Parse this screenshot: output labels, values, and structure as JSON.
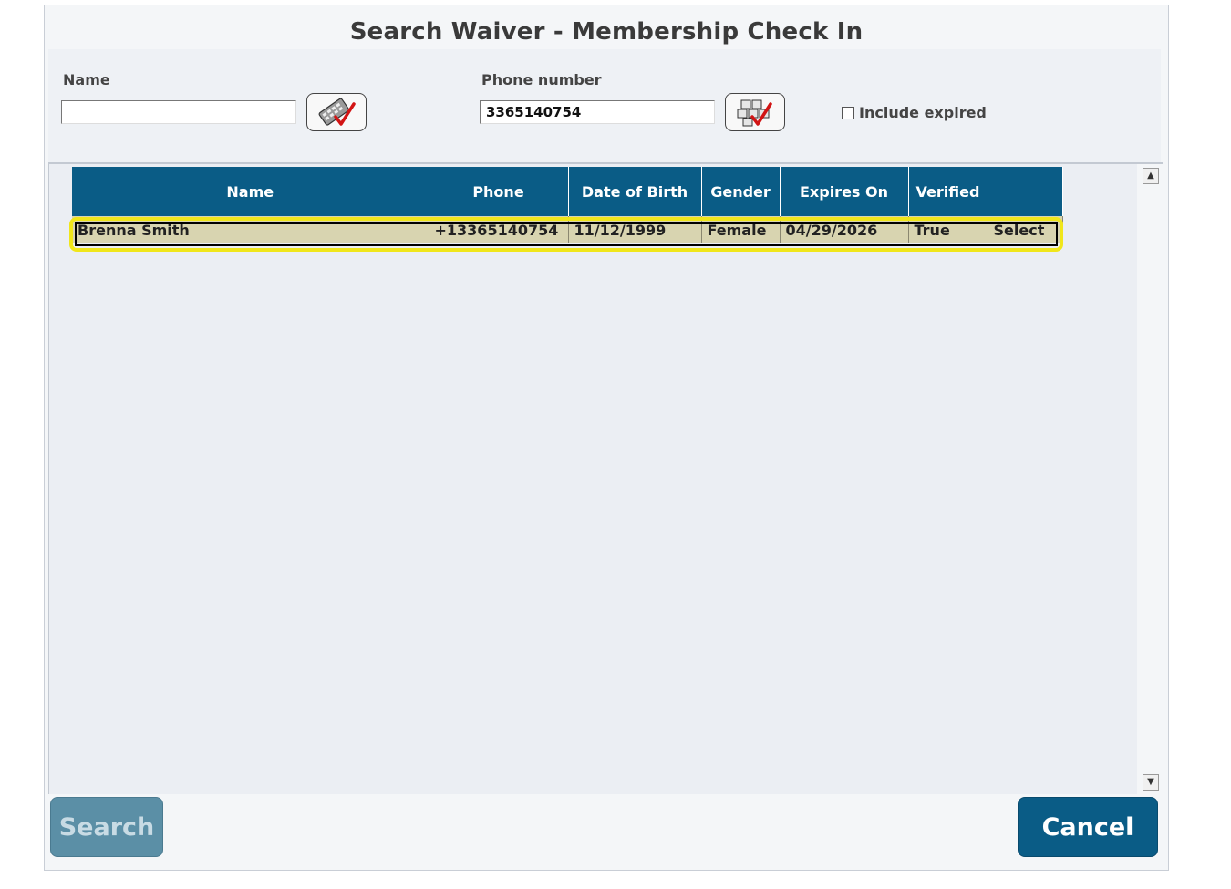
{
  "dialog": {
    "title": "Search Waiver - Membership Check In"
  },
  "form": {
    "name_label": "Name",
    "name_value": "",
    "phone_label": "Phone number",
    "phone_value": "3365140754",
    "include_expired_label": "Include expired",
    "include_expired_checked": false
  },
  "table": {
    "headers": [
      "Name",
      "Phone",
      "Date of Birth",
      "Gender",
      "Expires On",
      "Verified",
      ""
    ],
    "rows": [
      {
        "name": "Brenna Smith",
        "phone": "+13365140754",
        "dob": "11/12/1999",
        "gender": "Female",
        "expires_on": "04/29/2026",
        "verified": "True",
        "action": "Select"
      }
    ]
  },
  "buttons": {
    "search": "Search",
    "cancel": "Cancel"
  },
  "colors": {
    "header_bg": "#0a5c86",
    "row_bg": "#d8d4b0",
    "highlight": "#f0e61a"
  },
  "icons": {
    "name_keyboard": "keyboard-check-icon",
    "phone_keypad": "keypad-check-icon"
  }
}
